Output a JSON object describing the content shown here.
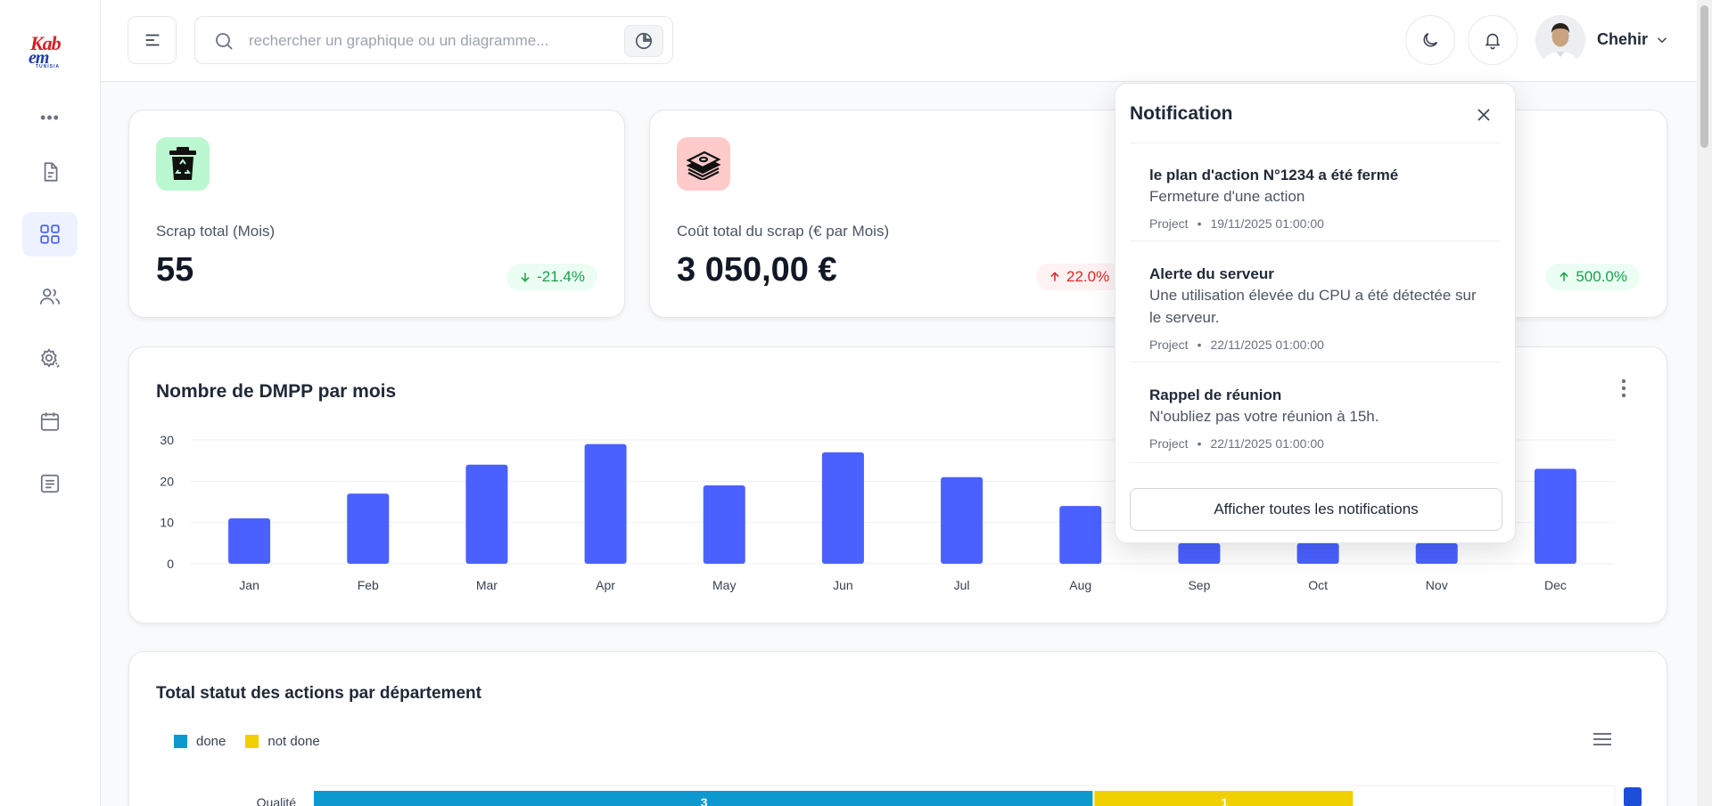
{
  "logo": {
    "line1": "Kab",
    "line2": "em",
    "line3": "TUNISIA"
  },
  "search": {
    "placeholder": "rechercher un graphique ou un diagramme..."
  },
  "user": {
    "name": "Chehir"
  },
  "kpis": [
    {
      "label": "Scrap total (Mois)",
      "value": "55",
      "change": "-21.4%",
      "direction": "down",
      "icon": "recycle-bin-icon",
      "icon_bg": "#bbf7d0"
    },
    {
      "label": "Coût total du scrap (€ par Mois)",
      "value": "3 050,00 €",
      "change": "22.0%",
      "direction": "up",
      "icon": "money-icon",
      "icon_bg": "#fecaca"
    },
    {
      "label": "",
      "value": "",
      "change": "500.0%",
      "direction": "up",
      "icon": "",
      "icon_bg": ""
    }
  ],
  "dmpp_chart": {
    "title": "Nombre de DMPP par mois",
    "chart_data": {
      "type": "bar",
      "categories": [
        "Jan",
        "Feb",
        "Mar",
        "Apr",
        "May",
        "Jun",
        "Jul",
        "Aug",
        "Sep",
        "Oct",
        "Nov",
        "Dec"
      ],
      "values": [
        11,
        17,
        24,
        29,
        19,
        27,
        21,
        14,
        5,
        5,
        5,
        23
      ],
      "ylim": [
        0,
        30
      ],
      "yticks": [
        0,
        10,
        20,
        30
      ],
      "color": "#4a61ff"
    }
  },
  "status_chart": {
    "title": "Total statut des actions par département",
    "chart_data": {
      "type": "bar",
      "orientation": "horizontal",
      "stacked": true,
      "categories": [
        "Qualité"
      ],
      "series": [
        {
          "name": "done",
          "values": [
            3
          ],
          "color": "#0e98d0"
        },
        {
          "name": "not done",
          "values": [
            1
          ],
          "color": "#f0d000"
        }
      ],
      "xlim": [
        0,
        5
      ]
    }
  },
  "notifications": {
    "title": "Notification",
    "items": [
      {
        "title": "le plan d'action N°1234 a été fermé",
        "desc": "Fermeture d'une action",
        "source": "Project",
        "time": "19/11/2025 01:00:00"
      },
      {
        "title": "Alerte du serveur",
        "desc": "Une utilisation élevée du CPU a été détectée sur le serveur.",
        "source": "Project",
        "time": "22/11/2025 01:00:00"
      },
      {
        "title": "Rappel de réunion",
        "desc": "N'oubliez pas votre réunion à 15h.",
        "source": "Project",
        "time": "22/11/2025 01:00:00"
      }
    ],
    "view_all": "Afficher toutes les notifications"
  }
}
